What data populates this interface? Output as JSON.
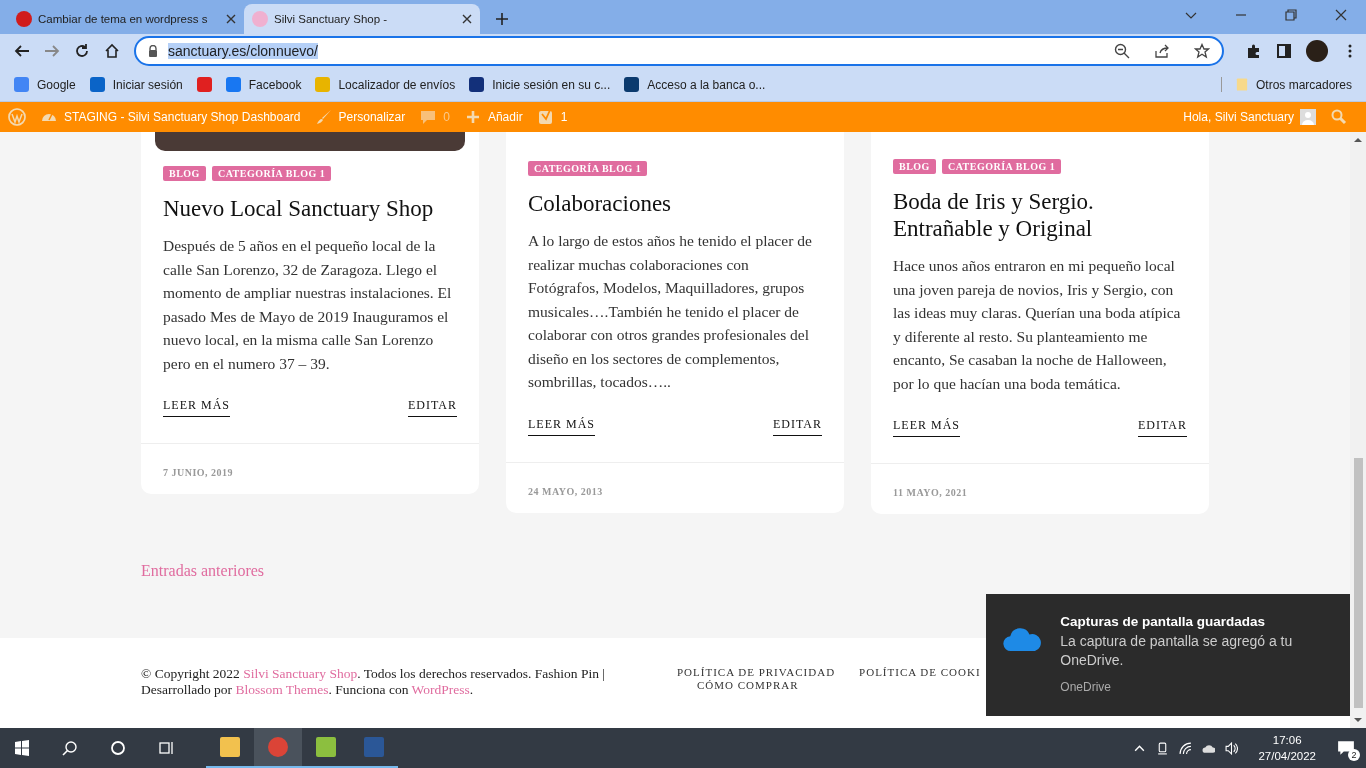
{
  "browser": {
    "tabs": [
      {
        "title": "Cambiar de tema en wordpress s",
        "selected": false
      },
      {
        "title": "Silvi Sanctuary Shop -",
        "selected": true
      }
    ],
    "url": "sanctuary.es/clonnuevo/",
    "bookmarks": [
      {
        "kind": "google",
        "label": "Google"
      },
      {
        "kind": "outlook",
        "label": "Iniciar sesión"
      },
      {
        "kind": "video"
      },
      {
        "kind": "facebook",
        "label": "Facebook"
      },
      {
        "kind": "post",
        "label": "Localizador de envíos"
      },
      {
        "kind": "pay",
        "label": "Inicie sesión en su c..."
      },
      {
        "kind": "bank",
        "label": "Acceso a la banca o..."
      }
    ],
    "other_bookmarks": "Otros marcadores"
  },
  "admin_bar": {
    "site": "STAGING - Silvi Sanctuary Shop Dashboard",
    "customize": "Personalizar",
    "comments": "0",
    "add": "Añadir",
    "seo_count": "1",
    "greeting": "Hola, Silvi Sanctuary"
  },
  "posts": [
    {
      "has_image": true,
      "tags": [
        "BLOG",
        "CATEGORÍA BLOG 1"
      ],
      "title": "Nuevo Local Sanctuary Shop",
      "excerpt": "Después de 5 años en el pequeño local de la calle San Lorenzo, 32 de Zaragoza. Llego el momento de ampliar nuestras instalaciones. El pasado Mes de Mayo de 2019 Inauguramos el nuevo local, en la misma calle San Lorenzo pero en el numero 37 – 39.",
      "read_more": "LEER MÁS",
      "edit": "EDITAR",
      "date": "7 JUNIO, 2019"
    },
    {
      "has_image": false,
      "tags": [
        "CATEGORÍA BLOG 1"
      ],
      "title": "Colaboraciones",
      "excerpt": "A lo largo de estos años he tenido el placer de realizar muchas colaboraciones con Fotógrafos, Modelos, Maquilladores, grupos musicales….También he tenido el placer de colaborar con otros grandes profesionales del diseño en los sectores de complementos, sombrillas, tocados…..",
      "read_more": "LEER MÁS",
      "edit": "EDITAR",
      "date": "24 MAYO, 2013"
    },
    {
      "has_image": false,
      "tags": [
        "BLOG",
        "CATEGORÍA BLOG 1"
      ],
      "title": "Boda de Iris y Sergio. Entrañable y Original",
      "excerpt": "Hace unos años entraron en mi pequeño local una joven pareja de novios, Iris y Sergio, con las ideas muy claras. Querían una boda atípica y diferente al resto. Su planteamiento me encanto, Se casaban la noche de Halloween, por lo que hacían una boda temática.",
      "read_more": "LEER MÁS",
      "edit": "EDITAR",
      "date": "11 MAYO, 2021"
    }
  ],
  "previous_posts": "Entradas anteriores",
  "footer": {
    "copyright": [
      {
        "kind": "text",
        "text": "© Copyright 2022 "
      },
      {
        "kind": "link",
        "text": "Silvi Sanctuary Shop"
      },
      {
        "kind": "text",
        "text": ". Todos los derechos reservados. Fashion Pin | Desarrollado por "
      },
      {
        "kind": "link",
        "text": "Blossom Themes"
      },
      {
        "kind": "text",
        "text": ". Funciona con "
      },
      {
        "kind": "link",
        "text": "WordPress"
      },
      {
        "kind": "text",
        "text": "."
      }
    ],
    "menu": [
      "POLÍTICA DE PRIVACIDAD",
      "POLÍTICA DE COOKI",
      "CÓMO COMPRAR"
    ]
  },
  "notification": {
    "title": "Capturas de pantalla guardadas",
    "message": "La captura de pantalla se agregó a tu OneDrive.",
    "source": "OneDrive"
  },
  "taskbar": {
    "apps": [
      {
        "kind": "folder",
        "selected": false
      },
      {
        "kind": "browser",
        "selected": true
      },
      {
        "kind": "pen",
        "selected": false
      },
      {
        "kind": "word",
        "selected": false
      }
    ],
    "time": "17:06",
    "date": "27/04/2022",
    "notifications": "2"
  }
}
